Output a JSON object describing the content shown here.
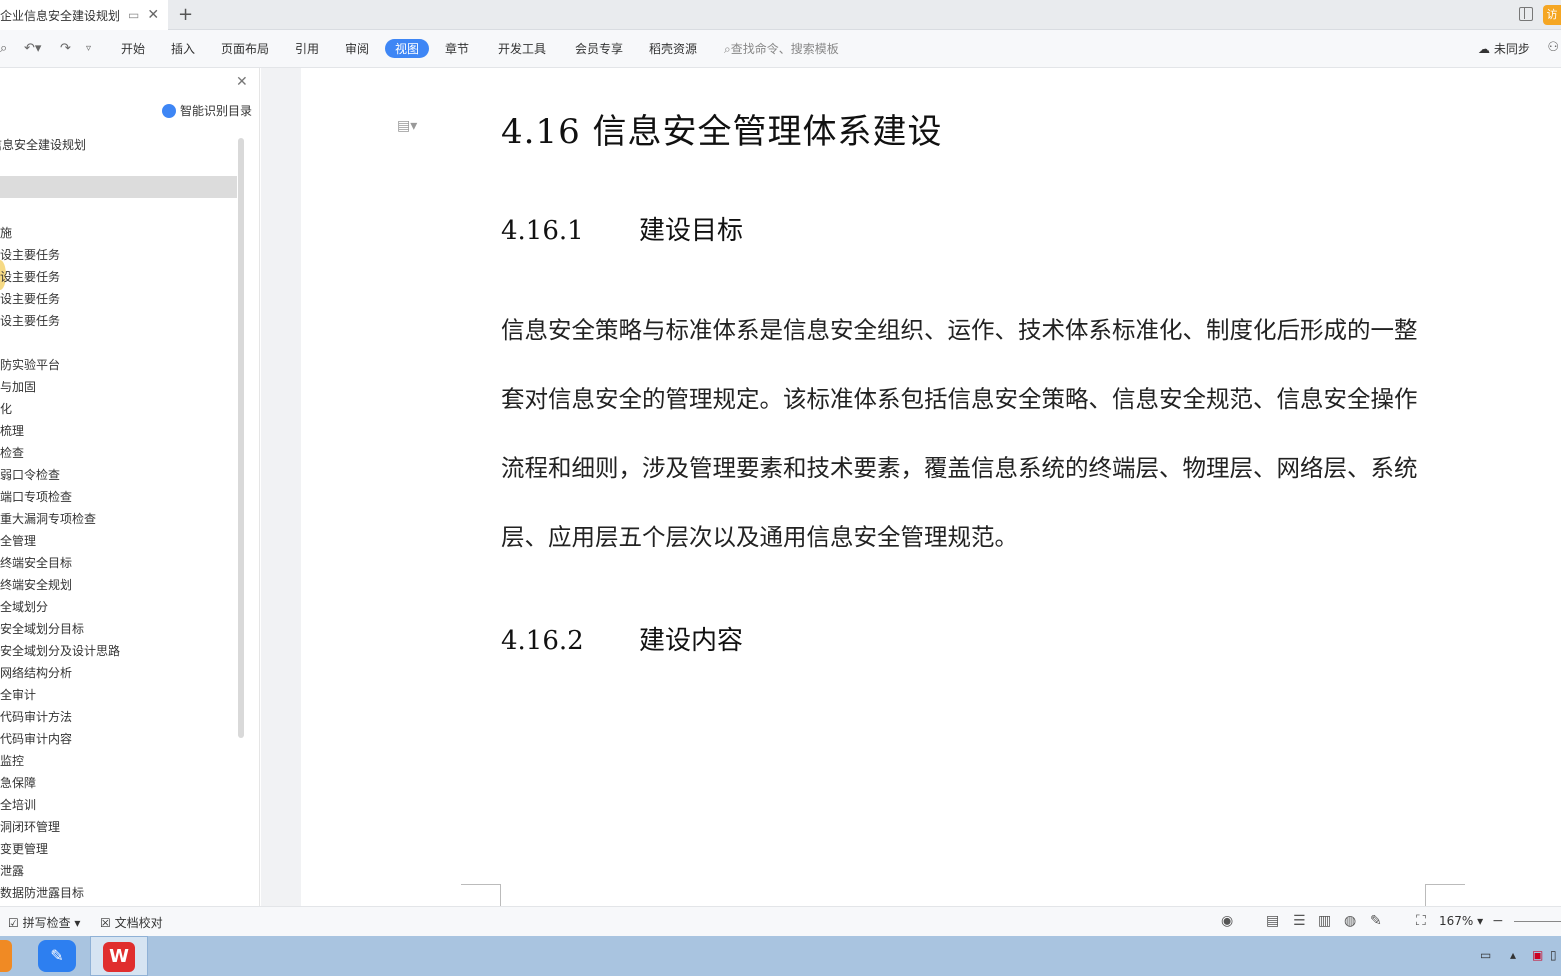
{
  "tab": {
    "title": "企业信息安全建设规划",
    "visit_label": "访"
  },
  "ribbon": {
    "menus": [
      "开始",
      "插入",
      "页面布局",
      "引用",
      "审阅",
      "视图",
      "章节",
      "开发工具",
      "会员专享",
      "稻壳资源"
    ],
    "active_menu": "视图",
    "search_placeholder": "查找命令、搜索模板",
    "sync_label": "未同步"
  },
  "nav": {
    "smart_toc_label": "智能识别目录",
    "root": "信息安全建设规划",
    "items": [
      "施",
      "设主要任务",
      "设主要任务",
      "设主要任务",
      "设主要任务",
      "",
      "防实验平台",
      "与加固",
      "化",
      "梳理",
      "检查",
      "弱口令检查",
      "端口专项检查",
      "重大漏洞专项检查",
      "全管理",
      "终端安全目标",
      "终端安全规划",
      "全域划分",
      "安全域划分目标",
      "安全域划分及设计思路",
      "网络结构分析",
      "全审计",
      "代码审计方法",
      "代码审计内容",
      "监控",
      "急保障",
      "全培训",
      "洞闭环管理",
      "变更管理",
      "泄露",
      "数据防泄露目标"
    ]
  },
  "document": {
    "h1": "4.16 信息安全管理体系建设",
    "sections": [
      {
        "num": "4.16.1",
        "title": "建设目标"
      },
      {
        "num": "4.16.2",
        "title": "建设内容"
      }
    ],
    "paragraph": "信息安全策略与标准体系是信息安全组织、运作、技术体系标准化、制度化后形成的一整套对信息安全的管理规定。该标准体系包括信息安全策略、信息安全规范、信息安全操作流程和细则，涉及管理要素和技术要素，覆盖信息系统的终端层、物理层、网络层、系统层、应用层五个层次以及通用信息安全管理规范。"
  },
  "status": {
    "spell_check": "拼写检查",
    "doc_proof": "文档校对",
    "zoom": "167%"
  },
  "colors": {
    "accent": "#3e86f5",
    "warn": "#f5a623"
  }
}
